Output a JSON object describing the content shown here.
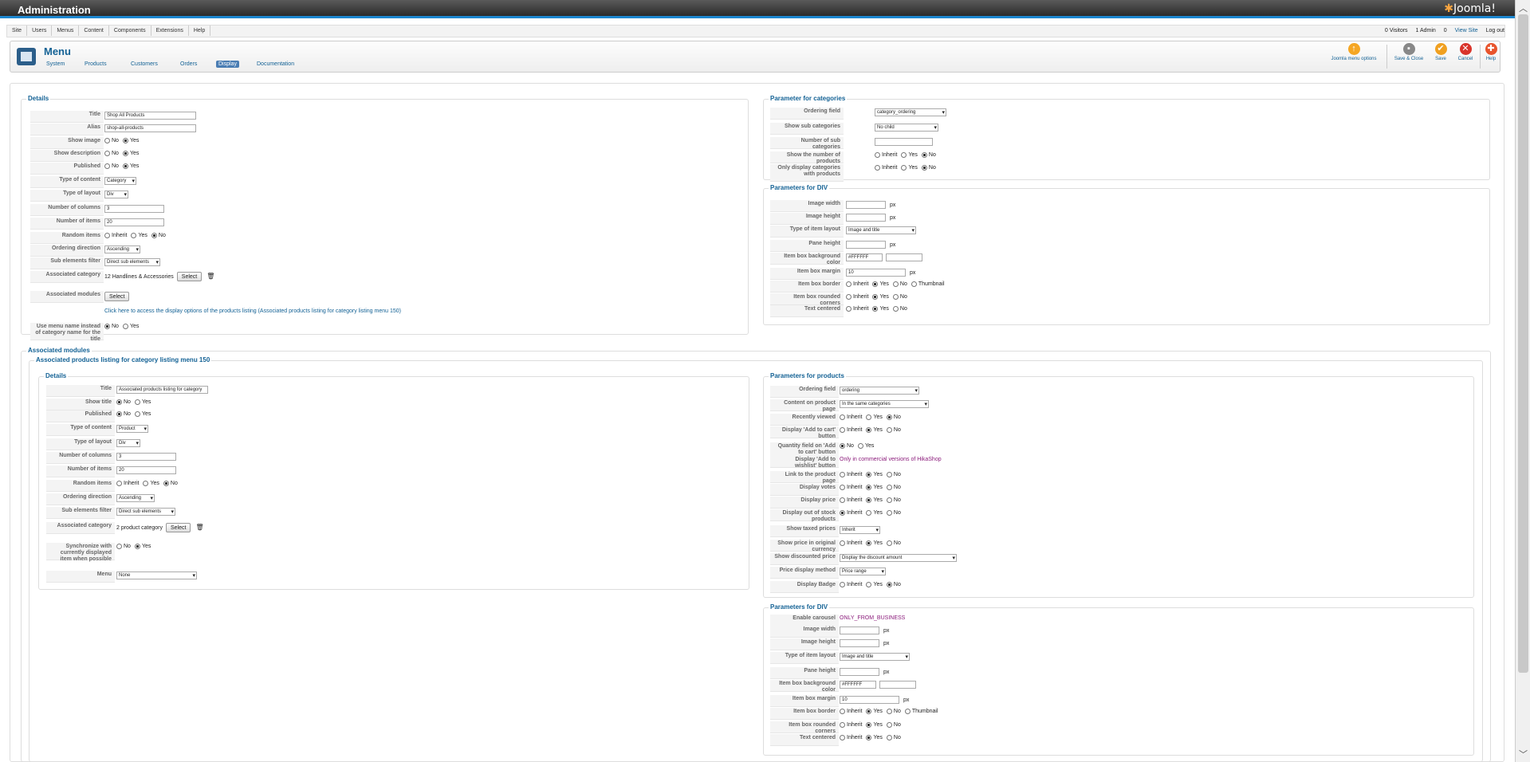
{
  "header": {
    "title": "Administration",
    "logo": "Joomla!"
  },
  "menu": [
    "Site",
    "Users",
    "Menus",
    "Content",
    "Components",
    "Extensions",
    "Help"
  ],
  "status": {
    "visitors": "0 Visitors",
    "admin": "1 Admin",
    "messages": "0",
    "view_site": "View Site",
    "logout": "Log out"
  },
  "toolbar": {
    "title": "Menu",
    "submenu": [
      "System",
      "Products",
      "Customers",
      "Orders",
      "Display",
      "Documentation"
    ],
    "buttons": [
      "Joomla menu options",
      "Save & Close",
      "Save",
      "Cancel",
      "Help"
    ]
  },
  "details": {
    "legend": "Details",
    "rows": [
      {
        "label": "Title",
        "value": "Shop All Products"
      },
      {
        "label": "Alias",
        "value": "shop-all-products"
      },
      {
        "label": "Show image",
        "no": "No",
        "yes": "Yes"
      },
      {
        "label": "Show description",
        "no": "No",
        "yes": "Yes"
      },
      {
        "label": "Published",
        "no": "No",
        "yes": "Yes"
      },
      {
        "label": "Type of content",
        "value": "Category"
      },
      {
        "label": "Type of layout",
        "value": "Div"
      },
      {
        "label": "Number of columns",
        "value": "3"
      },
      {
        "label": "Number of items",
        "value": "20"
      },
      {
        "label": "Random items",
        "opts": [
          "Inherit",
          "Yes",
          "No"
        ]
      },
      {
        "label": "Ordering direction",
        "value": "Ascending"
      },
      {
        "label": "Sub elements filter",
        "value": "Direct sub elements"
      },
      {
        "label": "Associated category",
        "value": "12 Handlines & Accessories",
        "btn": "Select"
      },
      {
        "label": "Associated modules",
        "btn": "Select"
      },
      {
        "link": "Click here to access the display options of the products listing (Associated products listing for category listing menu 150)"
      },
      {
        "label": "Use menu name instead of category name for the title",
        "no": "No",
        "yes": "Yes"
      }
    ]
  },
  "param_categories": {
    "legend": "Parameter for categories",
    "rows": [
      {
        "label": "Ordering field",
        "value": "category_ordering"
      },
      {
        "label": "Show sub categories",
        "value": "No child"
      },
      {
        "label": "Number of sub categories",
        "value": ""
      },
      {
        "label": "Show the number of products",
        "opts": [
          "Inherit",
          "Yes",
          "No"
        ]
      },
      {
        "label": "Only display categories with products",
        "opts": [
          "Inherit",
          "Yes",
          "No"
        ]
      }
    ]
  },
  "param_div": {
    "legend": "Parameters for DIV",
    "rows": [
      {
        "label": "Image width",
        "unit": "px"
      },
      {
        "label": "Image height",
        "unit": "px"
      },
      {
        "label": "Type of item layout",
        "value": "Image and title"
      },
      {
        "label": "Pane height",
        "unit": "px"
      },
      {
        "label": "Item box background color",
        "value": "#FFFFFF"
      },
      {
        "label": "Item box margin",
        "value": "10",
        "unit": "px"
      },
      {
        "label": "Item box border",
        "opts": [
          "Inherit",
          "Yes",
          "No",
          "Thumbnail"
        ]
      },
      {
        "label": "Item box rounded corners",
        "opts": [
          "Inherit",
          "Yes",
          "No"
        ]
      },
      {
        "label": "Text centered",
        "opts": [
          "Inherit",
          "Yes",
          "No"
        ]
      }
    ]
  },
  "assoc": {
    "legend": "Associated modules",
    "inner_legend": "Associated products listing for category listing menu 150"
  },
  "details2": {
    "legend": "Details",
    "rows": [
      {
        "label": "Title",
        "value": "Associated products listing for category"
      },
      {
        "label": "Show title",
        "no": "No",
        "yes": "Yes"
      },
      {
        "label": "Published",
        "no": "No",
        "yes": "Yes"
      },
      {
        "label": "Type of content",
        "value": "Product"
      },
      {
        "label": "Type of layout",
        "value": "Div"
      },
      {
        "label": "Number of columns",
        "value": "3"
      },
      {
        "label": "Number of items",
        "value": "20"
      },
      {
        "label": "Random items",
        "opts": [
          "Inherit",
          "Yes",
          "No"
        ]
      },
      {
        "label": "Ordering direction",
        "value": "Ascending"
      },
      {
        "label": "Sub elements filter",
        "value": "Direct sub elements"
      },
      {
        "label": "Associated category",
        "value": "2 product category",
        "btn": "Select"
      },
      {
        "label": "Synchronize with currently displayed item when possible",
        "no": "No",
        "yes": "Yes"
      },
      {
        "label": "Menu",
        "value": "None"
      }
    ]
  },
  "param_products": {
    "legend": "Parameters for products",
    "rows": [
      {
        "label": "Ordering field",
        "value": "ordering"
      },
      {
        "label": "Content on product page",
        "value": "In the same categories"
      },
      {
        "label": "Recently viewed",
        "opts": [
          "Inherit",
          "Yes",
          "No"
        ]
      },
      {
        "label": "Display 'Add to cart' button",
        "opts": [
          "Inherit",
          "Yes",
          "No"
        ]
      },
      {
        "label": "Quantity field on 'Add to cart' button",
        "opts": [
          "No",
          "Yes"
        ]
      },
      {
        "label": "Display 'Add to wishlist' button",
        "note": "Only in commercial versions of HikaShop"
      },
      {
        "label": "Link to the product page",
        "opts": [
          "Inherit",
          "Yes",
          "No"
        ]
      },
      {
        "label": "Display votes",
        "opts": [
          "Inherit",
          "Yes",
          "No"
        ]
      },
      {
        "label": "Display price",
        "opts": [
          "Inherit",
          "Yes",
          "No"
        ]
      },
      {
        "label": "Display out of stock products",
        "opts": [
          "Inherit",
          "Yes",
          "No"
        ]
      },
      {
        "label": "Show taxed prices",
        "value": "Inherit"
      },
      {
        "label": "Show price in original currency",
        "opts": [
          "Inherit",
          "Yes",
          "No"
        ]
      },
      {
        "label": "Show discounted price",
        "value": "Display the discount amount"
      },
      {
        "label": "Price display method",
        "value": "Price range"
      },
      {
        "label": "Display Badge",
        "opts": [
          "Inherit",
          "Yes",
          "No"
        ]
      }
    ]
  },
  "param_div2": {
    "legend": "Parameters for DIV",
    "rows": [
      {
        "label": "Enable carousel",
        "note": "ONLY_FROM_BUSINESS"
      },
      {
        "label": "Image width",
        "unit": "px"
      },
      {
        "label": "Image height",
        "unit": "px"
      },
      {
        "label": "Type of item layout",
        "value": "Image and title"
      },
      {
        "label": "Pane height",
        "unit": "px"
      },
      {
        "label": "Item box background color",
        "value": "#FFFFFF"
      },
      {
        "label": "Item box margin",
        "value": "10",
        "unit": "px"
      },
      {
        "label": "Item box border",
        "opts": [
          "Inherit",
          "Yes",
          "No",
          "Thumbnail"
        ]
      },
      {
        "label": "Item box rounded corners",
        "opts": [
          "Inherit",
          "Yes",
          "No"
        ]
      },
      {
        "label": "Text centered",
        "opts": [
          "Inherit",
          "Yes",
          "No"
        ]
      }
    ]
  }
}
